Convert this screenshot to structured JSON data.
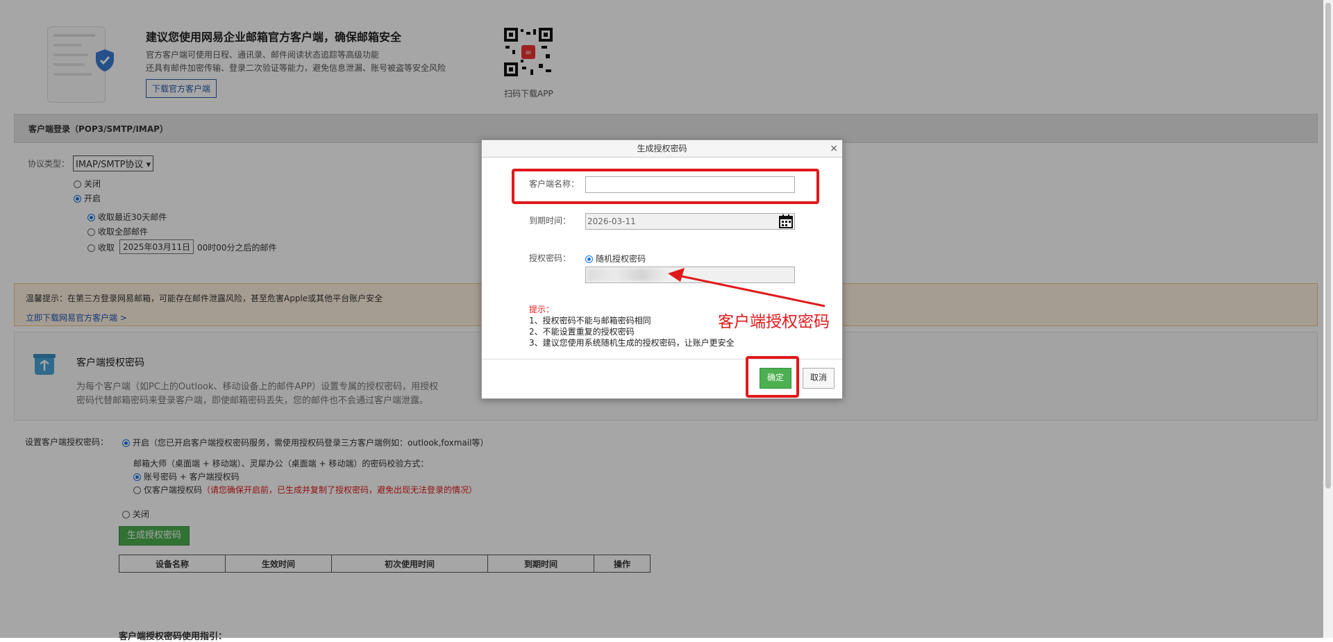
{
  "promo": {
    "title": "建议您使用网易企业邮箱官方客户端，确保邮箱安全",
    "line1": "官方客户端可使用日程、通讯录、邮件阅读状态追踪等高级功能",
    "line2": "还具有邮件加密传输、登录二次验证等能力，避免信息泄漏、账号被盗等安全风险",
    "download_button": "下载官方客户端",
    "qr_caption": "扫码下载APP"
  },
  "client_login": {
    "header": "客户端登录（POP3/SMTP/IMAP）",
    "protocol_label": "协议类型：",
    "protocol_value": "IMAP/SMTP协议",
    "off_label": "关闭",
    "on_label": "开启",
    "opt_recent": "收取最近30天邮件",
    "opt_all": "收取全部邮件",
    "opt_since_prefix": "收取",
    "opt_since_date": "2025年03月11日",
    "opt_since_suffix": "00时00分之后的邮件"
  },
  "warning": {
    "text": "温馨提示：在第三方登录网易邮箱，可能存在邮件泄露风险，甚至危害Apple或其他平台账户安全",
    "link": "立即下载网易官方客户端 >"
  },
  "auth_section": {
    "title": "客户端授权密码",
    "desc1": "为每个客户端（如PC上的Outlook、移动设备上的邮件APP）设置专属的授权密码，用授权",
    "desc2": "密码代替邮箱密码来登录客户端，即使邮箱密码丢失，您的邮件也不会通过客户端泄露。",
    "setting_label": "设置客户端授权密码：",
    "on_text": "开启（您已开启客户端授权密码服务，需使用授权码登录三方客户端例如：outlook,foxmail等）",
    "verify_label": "邮箱大师（桌面端 + 移动端）、灵犀办公（桌面端 + 移动端）的密码校验方式：",
    "verify_opt1": "账号密码 + 客户端授权码",
    "verify_opt2": "仅客户端授权码",
    "verify_opt2_warn": "（请您确保开启前，已生成并复制了授权密码，避免出现无法登录的情况）",
    "off_text": "关闭",
    "generate_button": "生成授权密码",
    "table_headers": [
      "设备名称",
      "生效时间",
      "初次使用时间",
      "到期时间",
      "操作"
    ],
    "guide_title": "客户端授权密码使用指引："
  },
  "dialog": {
    "title": "生成授权密码",
    "close_symbol": "×",
    "client_name_label": "客户端名称：",
    "client_name_value": "",
    "expire_label": "到期时间：",
    "expire_value": "2026-03-11",
    "password_label": "授权密码：",
    "random_label": "随机授权密码",
    "hint_title": "提示：",
    "hint1": "1、授权密码不能与邮箱密码相同",
    "hint2": "2、不能设置重复的授权密码",
    "hint3": "3、建议您使用系统随机生成的授权密码，让账户更安全",
    "ok_button": "确定",
    "cancel_button": "取消"
  },
  "annotation": {
    "text": "客户端授权密码",
    "color": "#e0191b"
  },
  "colors": {
    "accent_green": "#4caf50",
    "link_blue": "#1f5ab8",
    "warning_bg": "#fff1e0"
  }
}
